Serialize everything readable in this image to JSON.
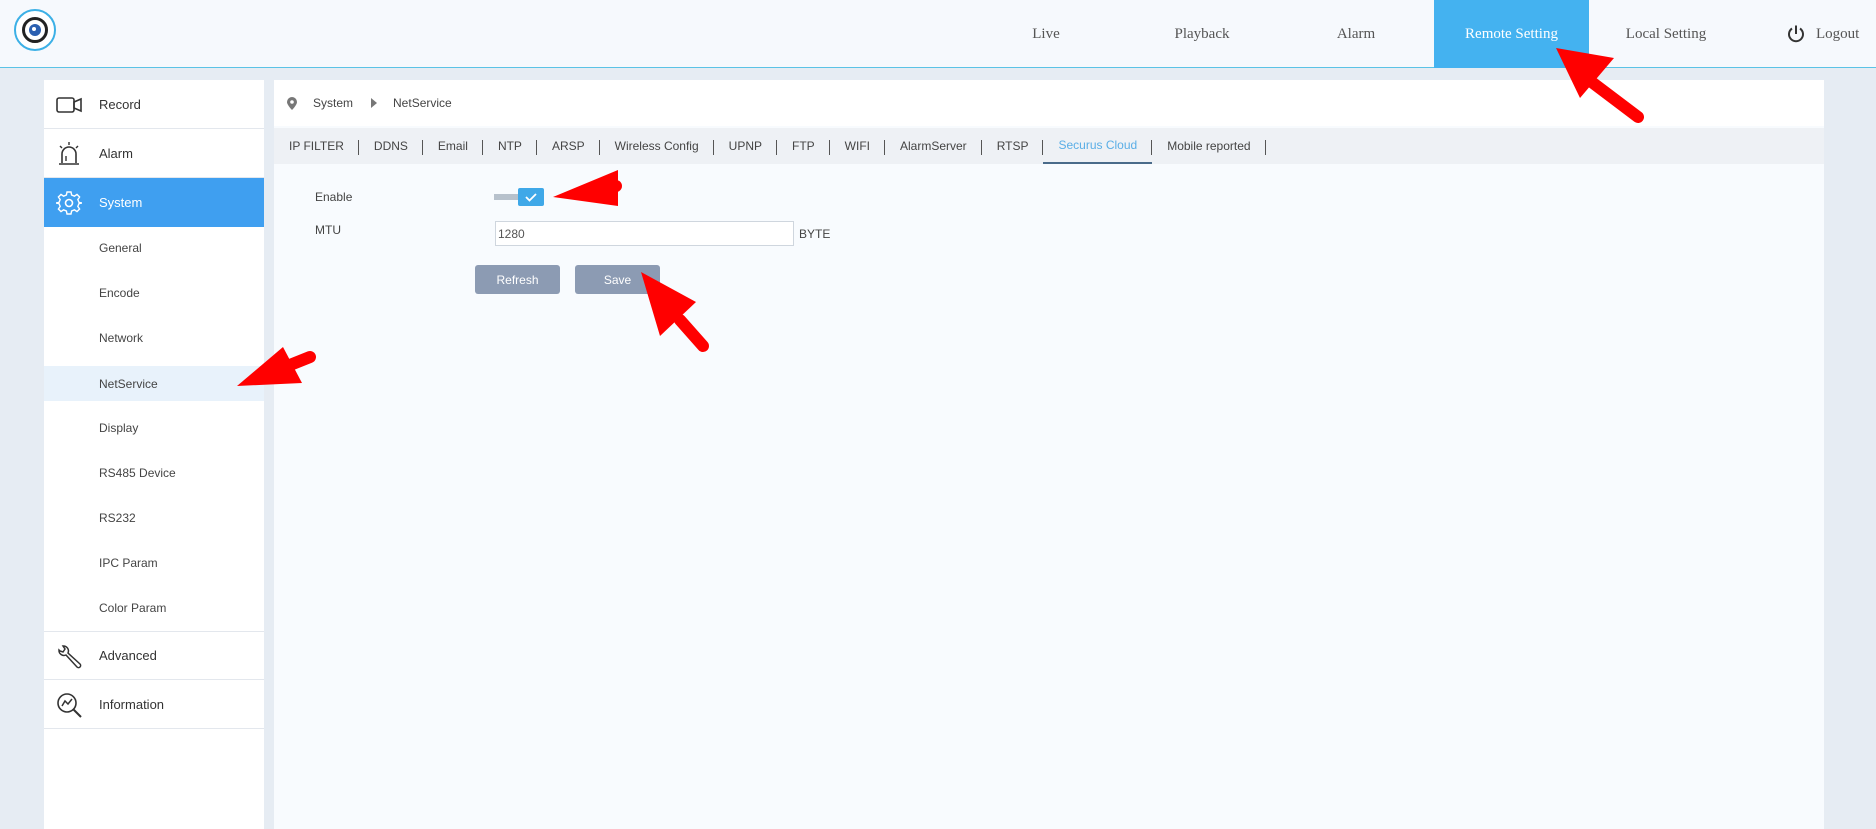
{
  "topbar": {
    "nav": [
      {
        "label": "Live",
        "active": false
      },
      {
        "label": "Playback",
        "active": false
      },
      {
        "label": "Alarm",
        "active": false
      },
      {
        "label": "Remote Setting",
        "active": true
      },
      {
        "label": "Local Setting",
        "active": false
      }
    ],
    "logout_label": "Logout"
  },
  "sidebar": {
    "main": [
      {
        "label": "Record",
        "icon": "camera-icon"
      },
      {
        "label": "Alarm",
        "icon": "siren-icon"
      },
      {
        "label": "System",
        "icon": "gear-icon"
      },
      {
        "label": "Advanced",
        "icon": "wrench-icon"
      },
      {
        "label": "Information",
        "icon": "chart-search-icon"
      }
    ],
    "sub": [
      "General",
      "Encode",
      "Network",
      "NetService",
      "Display",
      "RS485 Device",
      "RS232",
      "IPC Param",
      "Color Param"
    ],
    "active_main": "System",
    "active_sub": "NetService"
  },
  "breadcrumb": {
    "items": [
      "System",
      "NetService"
    ]
  },
  "tabs": [
    "IP FILTER",
    "DDNS",
    "Email",
    "NTP",
    "ARSP",
    "Wireless Config",
    "UPNP",
    "FTP",
    "WIFI",
    "AlarmServer",
    "RTSP",
    "Securus Cloud",
    "Mobile reported"
  ],
  "active_tab": "Securus Cloud",
  "form": {
    "enable_label": "Enable",
    "enable_checked": true,
    "mtu_label": "MTU",
    "mtu_value": "1280",
    "mtu_unit": "BYTE",
    "refresh_label": "Refresh",
    "save_label": "Save"
  },
  "colors": {
    "accent": "#44b2f0",
    "sidebar_active": "#3f9ff0",
    "button": "#8c9bb3",
    "annotation_arrow": "#ff0000"
  }
}
